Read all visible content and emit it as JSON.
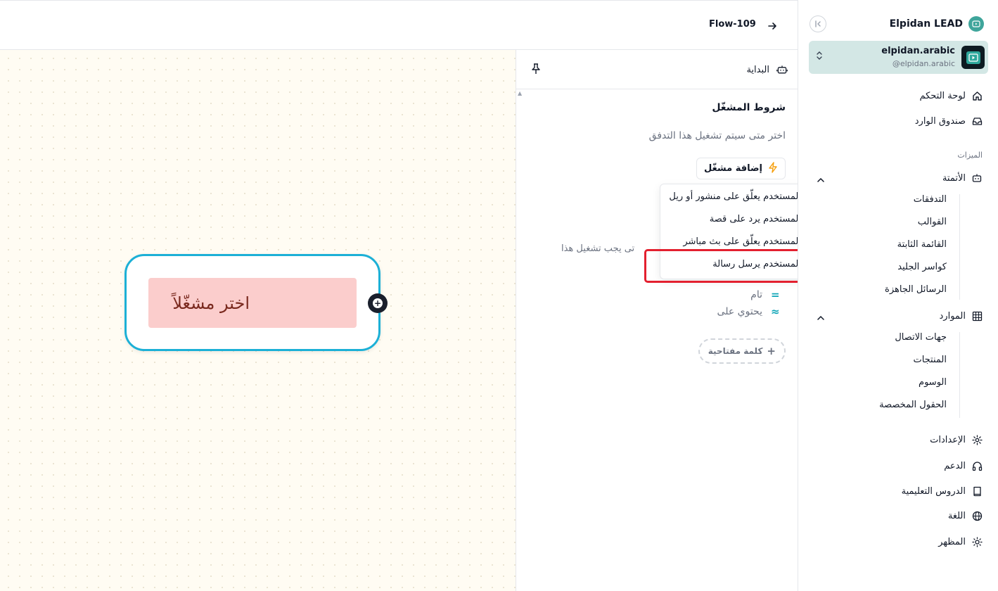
{
  "header": {
    "flow_title": "Flow-109"
  },
  "sidebar": {
    "brand": "Elpidan LEAD",
    "account": {
      "name": "elpidan.arabic",
      "handle": "@elpidan.arabic"
    },
    "items_top": [
      {
        "label": "لوحة التحكم",
        "icon": "home-icon"
      },
      {
        "label": "صندوق الوارد",
        "icon": "inbox-icon"
      }
    ],
    "section_features": "الميزات",
    "automation": {
      "label": "الأتمتة",
      "icon": "bot-icon",
      "children": [
        "التدفقات",
        "القوالب",
        "القائمة الثابتة",
        "كواسر الجليد",
        "الرسائل الجاهزة"
      ]
    },
    "resources": {
      "label": "الموارد",
      "icon": "grid-icon",
      "children": [
        "جهات الاتصال",
        "المنتجات",
        "الوسوم",
        "الحقول المخصصة"
      ]
    },
    "items_bottom": [
      {
        "label": "الإعدادات",
        "icon": "gear-icon"
      },
      {
        "label": "الدعم",
        "icon": "headphones-icon"
      },
      {
        "label": "الدروس التعليمية",
        "icon": "book-icon"
      },
      {
        "label": "اللغة",
        "icon": "globe-icon"
      },
      {
        "label": "المظهر",
        "icon": "sun-icon"
      }
    ]
  },
  "canvas": {
    "node_label": "اختر مشغّلاً"
  },
  "panel": {
    "title": "البداية",
    "trigger_heading": "شروط المشغّل",
    "trigger_desc": "اختر متى سيتم تشغيل هذا التدفق",
    "add_trigger": "إضافة مشغّل",
    "partial_text": "تى يجب تشغيل هذا",
    "match_options": [
      {
        "symbol": "=",
        "label": "تام"
      },
      {
        "symbol": "≈",
        "label": "يحتوي على"
      }
    ],
    "add_keyword": "كلمة مفتاحية",
    "dropdown_items": [
      "المستخدم يعلّق على منشور أو ريل",
      "المستخدم يرد على قصة",
      "المستخدم يعلّق على بث مباشر",
      "المستخدم يرسل رسالة"
    ]
  },
  "colors": {
    "accent_teal": "#3fa59b",
    "node_border": "#1cb0d6",
    "node_label_bg": "#fbcdcc",
    "highlight": "#e3202f"
  }
}
